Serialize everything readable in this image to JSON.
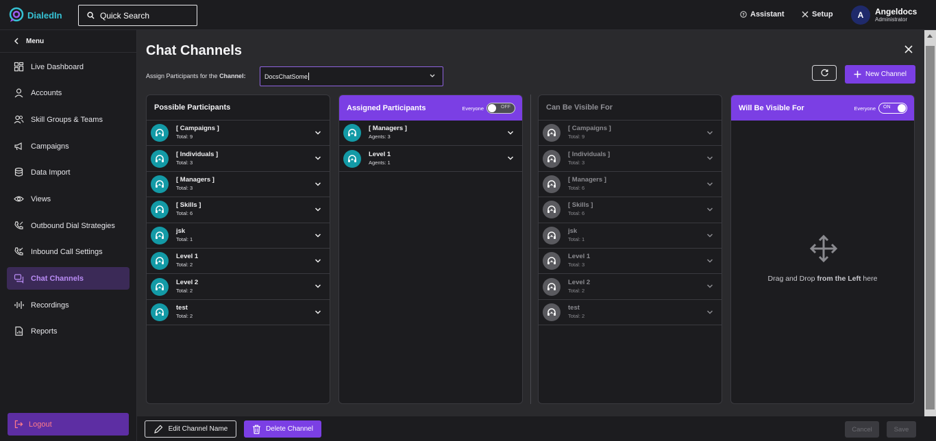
{
  "app": {
    "name": "DialedIn"
  },
  "search": {
    "label": "Quick Search"
  },
  "topnav": {
    "assistant": "Assistant",
    "setup": "Setup"
  },
  "user": {
    "initial": "A",
    "name": "Angeldocs",
    "role": "Administrator"
  },
  "sidebar": {
    "menu_label": "Menu",
    "items": [
      {
        "label": "Live Dashboard",
        "icon": "dashboard-icon"
      },
      {
        "label": "Accounts",
        "icon": "user-icon"
      },
      {
        "label": "Skill Groups & Teams",
        "icon": "users-icon"
      },
      {
        "label": "Campaigns",
        "icon": "megaphone-icon"
      },
      {
        "label": "Data Import",
        "icon": "database-icon"
      },
      {
        "label": "Views",
        "icon": "eye-icon"
      },
      {
        "label": "Outbound Dial Strategies",
        "icon": "phone-outgoing-icon"
      },
      {
        "label": "Inbound Call Settings",
        "icon": "phone-incoming-icon"
      },
      {
        "label": "Chat Channels",
        "icon": "chat-icon",
        "active": true
      },
      {
        "label": "Recordings",
        "icon": "waveform-icon"
      },
      {
        "label": "Reports",
        "icon": "report-icon"
      }
    ],
    "logout": "Logout"
  },
  "page": {
    "title": "Chat Channels",
    "assign_prefix": "Assign Participants for the ",
    "assign_bold": "Channel:",
    "channel_value": "DocsChatSome",
    "new_channel": "New Channel"
  },
  "panels": {
    "possible": {
      "title": "Possible Participants",
      "rows": [
        {
          "name": "[ Campaigns ]",
          "sub": "Total: 9"
        },
        {
          "name": "[ Individuals ]",
          "sub": "Total: 3"
        },
        {
          "name": "[ Managers ]",
          "sub": "Total: 3"
        },
        {
          "name": "[ Skills ]",
          "sub": "Total: 6"
        },
        {
          "name": "jsk",
          "sub": "Total: 1"
        },
        {
          "name": "Level 1",
          "sub": "Total: 2"
        },
        {
          "name": "Level 2",
          "sub": "Total: 2"
        },
        {
          "name": "test",
          "sub": "Total: 2"
        }
      ]
    },
    "assigned": {
      "title": "Assigned Participants",
      "everyone_label": "Everyone",
      "toggle_text": "OFF",
      "rows": [
        {
          "name": "[ Managers ]",
          "sub": "Agents: 3"
        },
        {
          "name": "Level 1",
          "sub": "Agents: 1"
        }
      ]
    },
    "can_visible": {
      "title": "Can Be Visible For",
      "rows": [
        {
          "name": "[ Campaigns ]",
          "sub": "Total: 9"
        },
        {
          "name": "[ Individuals ]",
          "sub": "Total: 3"
        },
        {
          "name": "[ Managers ]",
          "sub": "Total: 6"
        },
        {
          "name": "[ Skills ]",
          "sub": "Total: 6"
        },
        {
          "name": "jsk",
          "sub": "Total: 1"
        },
        {
          "name": "Level 1",
          "sub": "Total: 3"
        },
        {
          "name": "Level 2",
          "sub": "Total: 2"
        },
        {
          "name": "test",
          "sub": "Total: 2"
        }
      ]
    },
    "will_visible": {
      "title": "Will Be Visible For",
      "everyone_label": "Everyone",
      "toggle_text": "ON",
      "drop_pre": "Drag and Drop ",
      "drop_bold": "from the Left",
      "drop_post": " here"
    }
  },
  "footer": {
    "edit": "Edit Channel Name",
    "delete": "Delete Channel",
    "cancel": "Cancel",
    "save": "Save"
  },
  "colors": {
    "accent": "#7b3fe4",
    "teal": "#139aa6",
    "logout_text": "#ff7b8a"
  }
}
